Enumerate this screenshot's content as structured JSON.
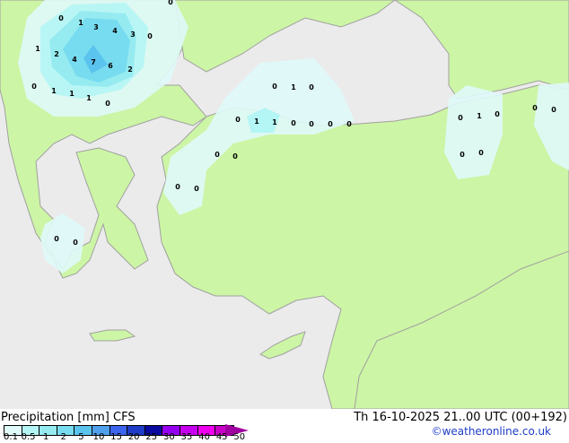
{
  "footer": {
    "title": "Precipitation [mm] CFS",
    "datetime": "Th 16-10-2025 21..00 UTC (00+192)",
    "credit": "©weatheronline.co.uk"
  },
  "legend": {
    "ticks": [
      "0.1",
      "0.5",
      "1",
      "2",
      "5",
      "10",
      "15",
      "20",
      "25",
      "30",
      "35",
      "40",
      "45",
      "50"
    ],
    "colors": [
      "#e0fafa",
      "#b4f5f5",
      "#96ebf0",
      "#78dcf0",
      "#5ac3ee",
      "#50a0ec",
      "#3c64ee",
      "#1e3cc8",
      "#0a0aa0",
      "#9600f0",
      "#c800f0",
      "#f000f0",
      "#c800c8"
    ],
    "overflow_color": "#a000a0"
  },
  "map": {
    "land_color": "#ccf5a5",
    "sea_color": "#ebebeb",
    "border_color": "#a0a0a0",
    "point_values": [
      "0",
      "1",
      "3",
      "4",
      "3",
      "0",
      "1",
      "2",
      "4",
      "7",
      "6",
      "2",
      "0",
      "1",
      "1",
      "1",
      "0",
      "0",
      "0",
      "1",
      "0",
      "0",
      "1",
      "1",
      "0",
      "0",
      "0",
      "0",
      "0",
      "0",
      "0",
      "0",
      "0",
      "1",
      "0",
      "0",
      "0",
      "0",
      "0",
      "0",
      "0"
    ]
  }
}
